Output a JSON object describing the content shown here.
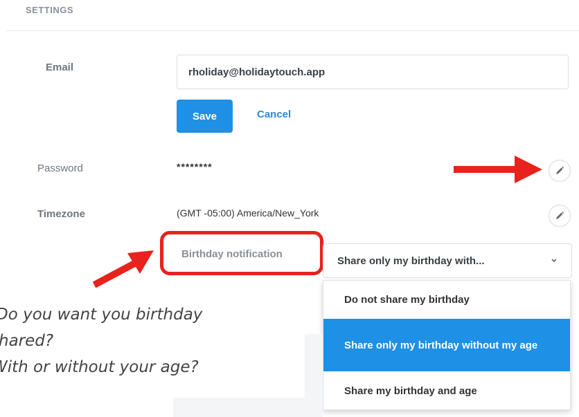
{
  "header": {
    "title": "SETTINGS"
  },
  "email": {
    "label": "Email",
    "value": "rholiday@holidaytouch.app",
    "save_label": "Save",
    "cancel_label": "Cancel"
  },
  "password": {
    "label": "Password",
    "value": "********"
  },
  "timezone": {
    "label": "Timezone",
    "value": "(GMT -05:00) America/New_York"
  },
  "birthday": {
    "label": "Birthday notification",
    "selected": "Share only my birthday with...",
    "options": [
      "Do not share my birthday",
      "Share only my birthday without my age",
      "Share my birthday and age"
    ],
    "selected_index": 1
  },
  "annotation": {
    "lines": [
      "Do you want you birthday",
      "hared?",
      "With or without your age?"
    ],
    "highlight_color": "#e8221c"
  },
  "colors": {
    "accent": "#1e90e6",
    "link": "#2c86d6"
  },
  "icons": {
    "edit": "pencil-icon",
    "dropdown": "chevron-down-icon",
    "arrow": "red-arrow"
  }
}
